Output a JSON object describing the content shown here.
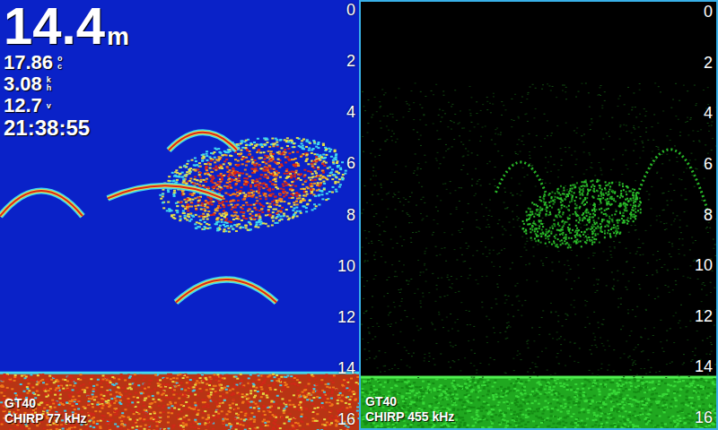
{
  "readouts": {
    "depth": {
      "value": "14.4",
      "unit": "m"
    },
    "items": [
      {
        "value": "17.86",
        "unit_top": "o",
        "unit_bottom": "c"
      },
      {
        "value": "3.08",
        "unit_top": "k",
        "unit_bottom": "h"
      },
      {
        "value": "12.7",
        "unit_top": "",
        "unit_bottom": "v"
      }
    ],
    "time": "21:38:55"
  },
  "panels": [
    {
      "transducer": "GT40",
      "mode": "CHIRP 77 kHz",
      "palette": "color",
      "scale": [
        "0",
        "2",
        "4",
        "6",
        "8",
        "10",
        "12",
        "14",
        "16"
      ],
      "bottom_depth": 14.3,
      "targets": [
        {
          "kind": "arch",
          "x0": 0.0,
          "x1": 0.23,
          "depth": 7.1,
          "drop": 1.0
        },
        {
          "kind": "arch",
          "x0": 0.49,
          "x1": 0.77,
          "depth": 10.6,
          "drop": 0.9
        },
        {
          "kind": "arch",
          "x0": 0.47,
          "x1": 0.66,
          "depth": 4.8,
          "drop": 0.7
        },
        {
          "kind": "arch",
          "x0": 0.3,
          "x1": 0.62,
          "depth": 6.9,
          "drop": 0.5
        },
        {
          "kind": "school",
          "x0": 0.44,
          "x1": 0.96,
          "depth": 5.0,
          "drop": 8.6
        }
      ]
    },
    {
      "transducer": "GT40",
      "mode": "CHIRP 455 kHz",
      "palette": "green",
      "scale": [
        "0",
        "2",
        "4",
        "6",
        "8",
        "10",
        "12",
        "14",
        "16"
      ],
      "bottom_depth": 14.4,
      "targets": [
        {
          "kind": "arch",
          "x0": 0.38,
          "x1": 0.52,
          "depth": 5.9,
          "drop": 1.2
        },
        {
          "kind": "arch",
          "x0": 0.76,
          "x1": 0.98,
          "depth": 5.4,
          "drop": 2.6
        },
        {
          "kind": "school",
          "x0": 0.45,
          "x1": 0.79,
          "depth": 6.6,
          "drop": 9.2
        }
      ]
    }
  ]
}
